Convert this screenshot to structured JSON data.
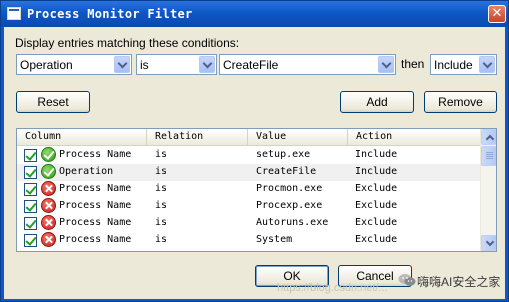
{
  "window": {
    "title": "Process Monitor Filter",
    "close_glyph": "✕"
  },
  "conditions": {
    "label": "Display entries matching these conditions:",
    "column_value": "Operation",
    "relation_value": "is",
    "value_value": "CreateFile",
    "then_label": "then",
    "action_value": "Include"
  },
  "buttons": {
    "reset": "Reset",
    "add": "Add",
    "remove": "Remove",
    "ok": "OK",
    "cancel": "Cancel"
  },
  "list": {
    "headers": [
      "Column",
      "Relation",
      "Value",
      "Action"
    ],
    "rows": [
      {
        "column": "Process Name",
        "relation": "is",
        "value": "setup.exe",
        "action": "Include",
        "icon": "check-icon",
        "checked": true
      },
      {
        "column": "Operation",
        "relation": "is",
        "value": "CreateFile",
        "action": "Include",
        "icon": "check-icon",
        "checked": true
      },
      {
        "column": "Process Name",
        "relation": "is",
        "value": "Procmon.exe",
        "action": "Exclude",
        "icon": "x-icon",
        "checked": true
      },
      {
        "column": "Process Name",
        "relation": "is",
        "value": "Procexp.exe",
        "action": "Exclude",
        "icon": "x-icon",
        "checked": true
      },
      {
        "column": "Process Name",
        "relation": "is",
        "value": "Autoruns.exe",
        "action": "Exclude",
        "icon": "x-icon",
        "checked": true
      },
      {
        "column": "Process Name",
        "relation": "is",
        "value": "System",
        "action": "Exclude",
        "icon": "x-icon",
        "checked": true
      }
    ]
  },
  "watermark": {
    "url_text": "https://blog.csdn.net/...",
    "brand_text": "嗨嗨AI安全之家"
  },
  "colors": {
    "titlebar": "#0d57c6",
    "dialog_bg": "#ece9d8",
    "include_icon": "#2c9a17",
    "exclude_icon": "#c61d1d"
  }
}
